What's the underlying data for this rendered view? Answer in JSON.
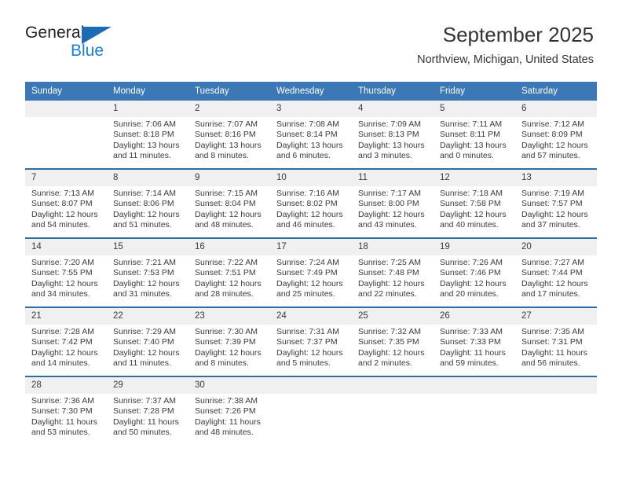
{
  "brand": {
    "name_part1": "General",
    "name_part2": "Blue",
    "colors": {
      "dark": "#231f20",
      "blue": "#1b7fd4",
      "flag": "#1b6cb5"
    }
  },
  "header": {
    "title": "September 2025",
    "location": "Northview, Michigan, United States"
  },
  "theme": {
    "header_bg": "#3c78b5",
    "header_text": "#ffffff",
    "daynum_bg": "#f0f0f0",
    "row_divider": "#2e6da4",
    "body_text": "#3a3a3a"
  },
  "weekday_headers": [
    "Sunday",
    "Monday",
    "Tuesday",
    "Wednesday",
    "Thursday",
    "Friday",
    "Saturday"
  ],
  "labels": {
    "sunrise_prefix": "Sunrise:",
    "sunset_prefix": "Sunset:",
    "daylight_prefix": "Daylight:"
  },
  "weeks": [
    {
      "days": [
        {
          "day": "",
          "empty": true,
          "sunrise": "",
          "sunset": "",
          "daylight_line1": "",
          "daylight_line2": ""
        },
        {
          "day": "1",
          "empty": false,
          "sunrise": "Sunrise: 7:06 AM",
          "sunset": "Sunset: 8:18 PM",
          "daylight_line1": "Daylight: 13 hours",
          "daylight_line2": "and 11 minutes."
        },
        {
          "day": "2",
          "empty": false,
          "sunrise": "Sunrise: 7:07 AM",
          "sunset": "Sunset: 8:16 PM",
          "daylight_line1": "Daylight: 13 hours",
          "daylight_line2": "and 8 minutes."
        },
        {
          "day": "3",
          "empty": false,
          "sunrise": "Sunrise: 7:08 AM",
          "sunset": "Sunset: 8:14 PM",
          "daylight_line1": "Daylight: 13 hours",
          "daylight_line2": "and 6 minutes."
        },
        {
          "day": "4",
          "empty": false,
          "sunrise": "Sunrise: 7:09 AM",
          "sunset": "Sunset: 8:13 PM",
          "daylight_line1": "Daylight: 13 hours",
          "daylight_line2": "and 3 minutes."
        },
        {
          "day": "5",
          "empty": false,
          "sunrise": "Sunrise: 7:11 AM",
          "sunset": "Sunset: 8:11 PM",
          "daylight_line1": "Daylight: 13 hours",
          "daylight_line2": "and 0 minutes."
        },
        {
          "day": "6",
          "empty": false,
          "sunrise": "Sunrise: 7:12 AM",
          "sunset": "Sunset: 8:09 PM",
          "daylight_line1": "Daylight: 12 hours",
          "daylight_line2": "and 57 minutes."
        }
      ]
    },
    {
      "days": [
        {
          "day": "7",
          "empty": false,
          "sunrise": "Sunrise: 7:13 AM",
          "sunset": "Sunset: 8:07 PM",
          "daylight_line1": "Daylight: 12 hours",
          "daylight_line2": "and 54 minutes."
        },
        {
          "day": "8",
          "empty": false,
          "sunrise": "Sunrise: 7:14 AM",
          "sunset": "Sunset: 8:06 PM",
          "daylight_line1": "Daylight: 12 hours",
          "daylight_line2": "and 51 minutes."
        },
        {
          "day": "9",
          "empty": false,
          "sunrise": "Sunrise: 7:15 AM",
          "sunset": "Sunset: 8:04 PM",
          "daylight_line1": "Daylight: 12 hours",
          "daylight_line2": "and 48 minutes."
        },
        {
          "day": "10",
          "empty": false,
          "sunrise": "Sunrise: 7:16 AM",
          "sunset": "Sunset: 8:02 PM",
          "daylight_line1": "Daylight: 12 hours",
          "daylight_line2": "and 46 minutes."
        },
        {
          "day": "11",
          "empty": false,
          "sunrise": "Sunrise: 7:17 AM",
          "sunset": "Sunset: 8:00 PM",
          "daylight_line1": "Daylight: 12 hours",
          "daylight_line2": "and 43 minutes."
        },
        {
          "day": "12",
          "empty": false,
          "sunrise": "Sunrise: 7:18 AM",
          "sunset": "Sunset: 7:58 PM",
          "daylight_line1": "Daylight: 12 hours",
          "daylight_line2": "and 40 minutes."
        },
        {
          "day": "13",
          "empty": false,
          "sunrise": "Sunrise: 7:19 AM",
          "sunset": "Sunset: 7:57 PM",
          "daylight_line1": "Daylight: 12 hours",
          "daylight_line2": "and 37 minutes."
        }
      ]
    },
    {
      "days": [
        {
          "day": "14",
          "empty": false,
          "sunrise": "Sunrise: 7:20 AM",
          "sunset": "Sunset: 7:55 PM",
          "daylight_line1": "Daylight: 12 hours",
          "daylight_line2": "and 34 minutes."
        },
        {
          "day": "15",
          "empty": false,
          "sunrise": "Sunrise: 7:21 AM",
          "sunset": "Sunset: 7:53 PM",
          "daylight_line1": "Daylight: 12 hours",
          "daylight_line2": "and 31 minutes."
        },
        {
          "day": "16",
          "empty": false,
          "sunrise": "Sunrise: 7:22 AM",
          "sunset": "Sunset: 7:51 PM",
          "daylight_line1": "Daylight: 12 hours",
          "daylight_line2": "and 28 minutes."
        },
        {
          "day": "17",
          "empty": false,
          "sunrise": "Sunrise: 7:24 AM",
          "sunset": "Sunset: 7:49 PM",
          "daylight_line1": "Daylight: 12 hours",
          "daylight_line2": "and 25 minutes."
        },
        {
          "day": "18",
          "empty": false,
          "sunrise": "Sunrise: 7:25 AM",
          "sunset": "Sunset: 7:48 PM",
          "daylight_line1": "Daylight: 12 hours",
          "daylight_line2": "and 22 minutes."
        },
        {
          "day": "19",
          "empty": false,
          "sunrise": "Sunrise: 7:26 AM",
          "sunset": "Sunset: 7:46 PM",
          "daylight_line1": "Daylight: 12 hours",
          "daylight_line2": "and 20 minutes."
        },
        {
          "day": "20",
          "empty": false,
          "sunrise": "Sunrise: 7:27 AM",
          "sunset": "Sunset: 7:44 PM",
          "daylight_line1": "Daylight: 12 hours",
          "daylight_line2": "and 17 minutes."
        }
      ]
    },
    {
      "days": [
        {
          "day": "21",
          "empty": false,
          "sunrise": "Sunrise: 7:28 AM",
          "sunset": "Sunset: 7:42 PM",
          "daylight_line1": "Daylight: 12 hours",
          "daylight_line2": "and 14 minutes."
        },
        {
          "day": "22",
          "empty": false,
          "sunrise": "Sunrise: 7:29 AM",
          "sunset": "Sunset: 7:40 PM",
          "daylight_line1": "Daylight: 12 hours",
          "daylight_line2": "and 11 minutes."
        },
        {
          "day": "23",
          "empty": false,
          "sunrise": "Sunrise: 7:30 AM",
          "sunset": "Sunset: 7:39 PM",
          "daylight_line1": "Daylight: 12 hours",
          "daylight_line2": "and 8 minutes."
        },
        {
          "day": "24",
          "empty": false,
          "sunrise": "Sunrise: 7:31 AM",
          "sunset": "Sunset: 7:37 PM",
          "daylight_line1": "Daylight: 12 hours",
          "daylight_line2": "and 5 minutes."
        },
        {
          "day": "25",
          "empty": false,
          "sunrise": "Sunrise: 7:32 AM",
          "sunset": "Sunset: 7:35 PM",
          "daylight_line1": "Daylight: 12 hours",
          "daylight_line2": "and 2 minutes."
        },
        {
          "day": "26",
          "empty": false,
          "sunrise": "Sunrise: 7:33 AM",
          "sunset": "Sunset: 7:33 PM",
          "daylight_line1": "Daylight: 11 hours",
          "daylight_line2": "and 59 minutes."
        },
        {
          "day": "27",
          "empty": false,
          "sunrise": "Sunrise: 7:35 AM",
          "sunset": "Sunset: 7:31 PM",
          "daylight_line1": "Daylight: 11 hours",
          "daylight_line2": "and 56 minutes."
        }
      ]
    },
    {
      "days": [
        {
          "day": "28",
          "empty": false,
          "sunrise": "Sunrise: 7:36 AM",
          "sunset": "Sunset: 7:30 PM",
          "daylight_line1": "Daylight: 11 hours",
          "daylight_line2": "and 53 minutes."
        },
        {
          "day": "29",
          "empty": false,
          "sunrise": "Sunrise: 7:37 AM",
          "sunset": "Sunset: 7:28 PM",
          "daylight_line1": "Daylight: 11 hours",
          "daylight_line2": "and 50 minutes."
        },
        {
          "day": "30",
          "empty": false,
          "sunrise": "Sunrise: 7:38 AM",
          "sunset": "Sunset: 7:26 PM",
          "daylight_line1": "Daylight: 11 hours",
          "daylight_line2": "and 48 minutes."
        },
        {
          "day": "",
          "empty": true,
          "sunrise": "",
          "sunset": "",
          "daylight_line1": "",
          "daylight_line2": ""
        },
        {
          "day": "",
          "empty": true,
          "sunrise": "",
          "sunset": "",
          "daylight_line1": "",
          "daylight_line2": ""
        },
        {
          "day": "",
          "empty": true,
          "sunrise": "",
          "sunset": "",
          "daylight_line1": "",
          "daylight_line2": ""
        },
        {
          "day": "",
          "empty": true,
          "sunrise": "",
          "sunset": "",
          "daylight_line1": "",
          "daylight_line2": ""
        }
      ]
    }
  ]
}
